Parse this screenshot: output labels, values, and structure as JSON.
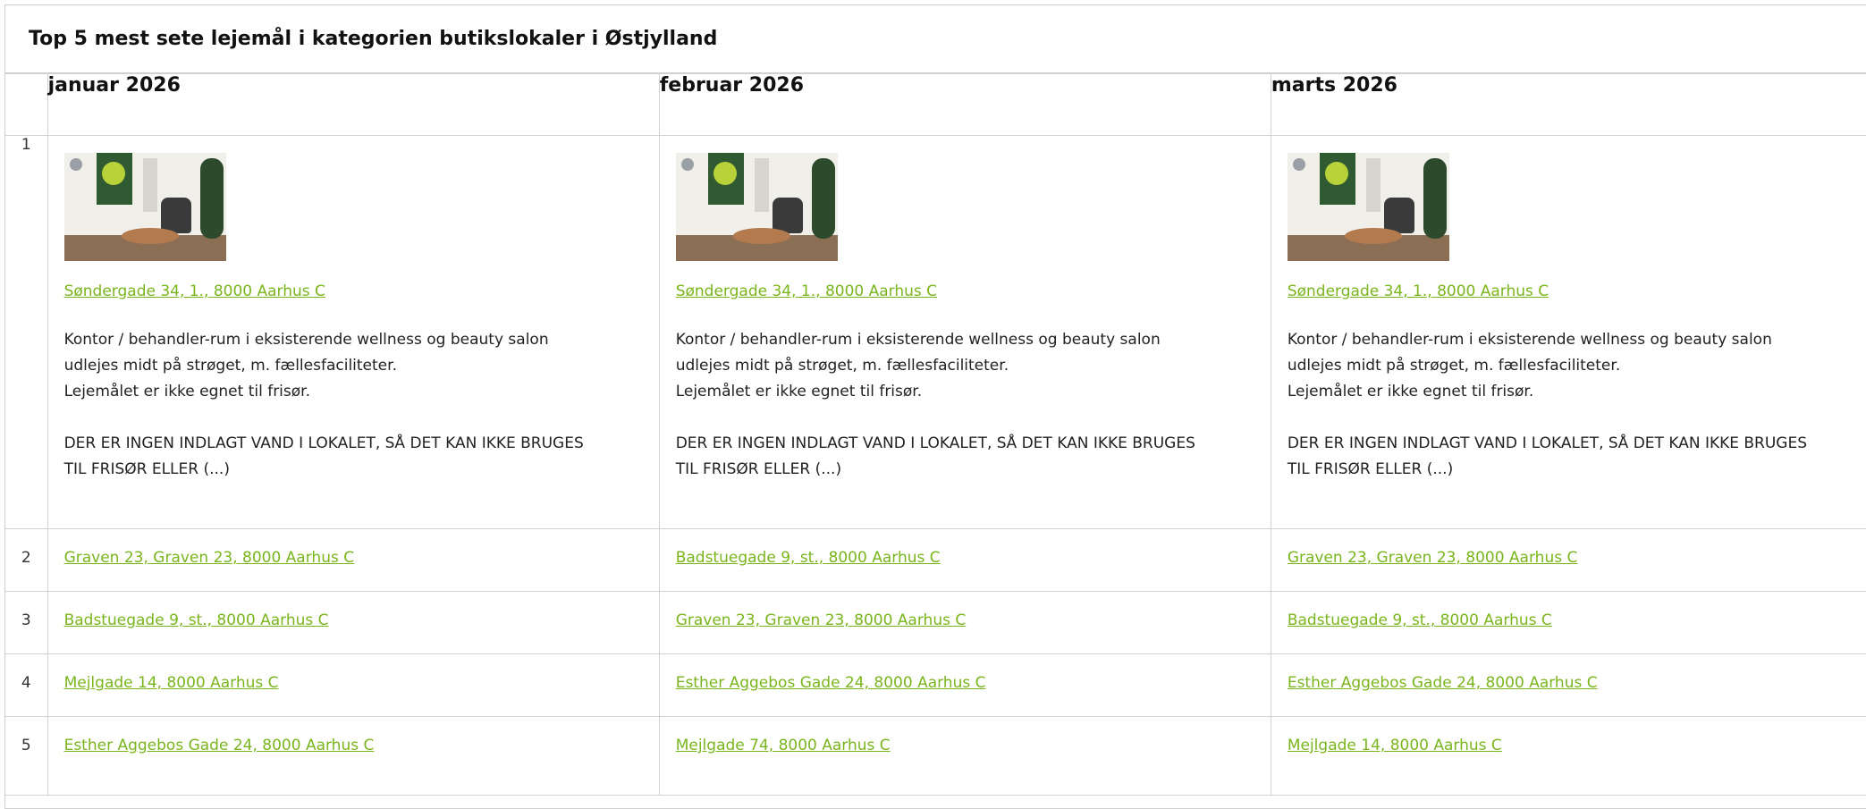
{
  "title": "Top 5 mest sete lejemål i kategorien butikslokaler i Østjylland",
  "months": [
    "januar 2026",
    "februar 2026",
    "marts 2026"
  ],
  "ranks": [
    "1",
    "2",
    "3",
    "4",
    "5"
  ],
  "top": {
    "image_icon": "office-interior-photo",
    "address": "Søndergade 34, 1., 8000 Aarhus C",
    "desc_line1": "Kontor / behandler-rum i eksisterende wellness og beauty salon",
    "desc_line2": "udlejes midt på strøget, m. fællesfaciliteter.",
    "desc_line3": "Lejemålet er ikke egnet til frisør.",
    "desc_line4": "DER ER INGEN INDLAGT VAND I LOKALET, SÅ DET KAN IKKE BRUGES",
    "desc_line5": "TIL FRISØR ELLER (...)"
  },
  "rows": [
    {
      "rank": "2",
      "cols": [
        "Graven 23, Graven 23, 8000 Aarhus C",
        "Badstuegade 9, st., 8000 Aarhus C",
        "Graven 23, Graven 23, 8000 Aarhus C"
      ]
    },
    {
      "rank": "3",
      "cols": [
        "Badstuegade 9, st., 8000 Aarhus C",
        "Graven 23, Graven 23, 8000 Aarhus C",
        "Badstuegade 9, st., 8000 Aarhus C"
      ]
    },
    {
      "rank": "4",
      "cols": [
        "Mejlgade 14, 8000 Aarhus C",
        "Esther Aggebos Gade 24, 8000 Aarhus C",
        "Esther Aggebos Gade 24, 8000 Aarhus C"
      ]
    },
    {
      "rank": "5",
      "cols": [
        "Esther Aggebos Gade 24, 8000 Aarhus C",
        "Mejlgade 74, 8000 Aarhus C",
        "Mejlgade 14, 8000 Aarhus C"
      ]
    }
  ],
  "colors": {
    "link": "#7ab51d",
    "border": "#d2d2d2"
  }
}
